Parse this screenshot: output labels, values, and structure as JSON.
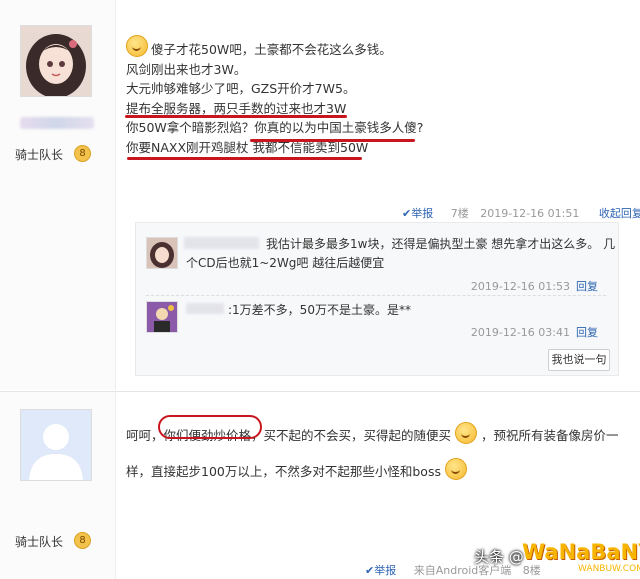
{
  "post1": {
    "rank": "骑士队长",
    "level": "8",
    "lines": [
      "傻子才花50W吧，土豪都不会花这么多钱。",
      "风剑刚出来也才3W。",
      "大元帅够难够少了吧，GZS开价才7W5。",
      "提布全服务器，两只手数的过来也才3W",
      "你50W拿个暗影烈焰？你真的以为中国土豪钱多人傻?",
      "你要NAXX刚开鸡腿杖 我都不信能卖到50W"
    ],
    "meta": {
      "report": "举报",
      "floor": "7楼",
      "time": "2019-12-16 01:51",
      "collapse": "收起回复"
    },
    "replies": [
      {
        "text1": "我估计最多最多1w块，还得是偏执型土豪 想先拿才出这么多。 几",
        "text2": "个CD后也就1~2Wg吧 越往后越便宜",
        "time": "2019-12-16 01:53",
        "reply": "回复"
      },
      {
        "text1": ":1万差不多，50万不是土豪。是**",
        "time": "2019-12-16 03:41",
        "reply": "回复"
      }
    ],
    "say_button": "我也说一句"
  },
  "post2": {
    "rank": "骑士队长",
    "level": "8",
    "line1_a": "呵呵，",
    "line1_b": "你们便劲炒价格",
    "line1_c": "，买不起的不会买，买得起的随便买",
    "line1_d": "，预祝所有装备像房价一",
    "line2": "样，直接起步100万以上，不然多对不起那些小怪和boss",
    "meta": {
      "report": "举报",
      "source": "来自Android客户端",
      "floor": "8楼"
    }
  },
  "watermark": {
    "text": "头条 @",
    "logo": "WaNaBaNY",
    "site": "WANBUW.COM"
  }
}
